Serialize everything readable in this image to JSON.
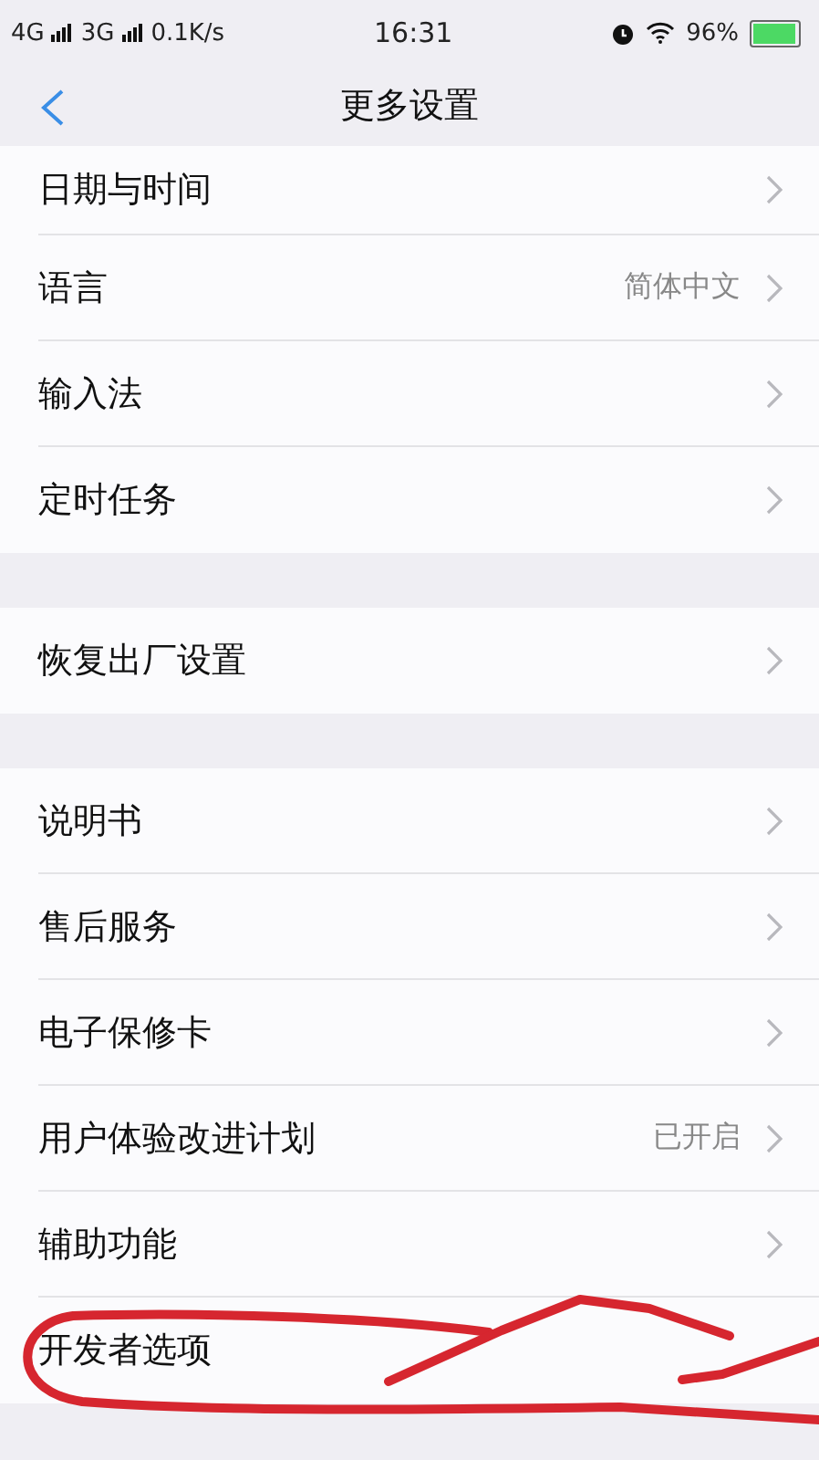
{
  "status_bar": {
    "network_1": "4G",
    "network_2": "3G",
    "speed": "0.1K/s",
    "time": "16:31",
    "battery": "96%"
  },
  "header": {
    "title": "更多设置"
  },
  "groups": [
    {
      "rows": [
        {
          "label": "日期与时间",
          "arrow": true
        },
        {
          "label": "语言",
          "value": "简体中文",
          "arrow": true
        },
        {
          "label": "输入法",
          "arrow": true
        },
        {
          "label": "定时任务",
          "arrow": true
        }
      ]
    },
    {
      "rows": [
        {
          "label": "恢复出厂设置",
          "arrow": true
        }
      ]
    },
    {
      "rows": [
        {
          "label": "说明书",
          "arrow": true
        },
        {
          "label": "售后服务",
          "arrow": true
        },
        {
          "label": "电子保修卡",
          "arrow": true
        },
        {
          "label": "用户体验改进计划",
          "value": "已开启",
          "arrow": true
        },
        {
          "label": "辅助功能",
          "arrow": true
        },
        {
          "label": "开发者选项",
          "arrow": false
        }
      ]
    }
  ]
}
